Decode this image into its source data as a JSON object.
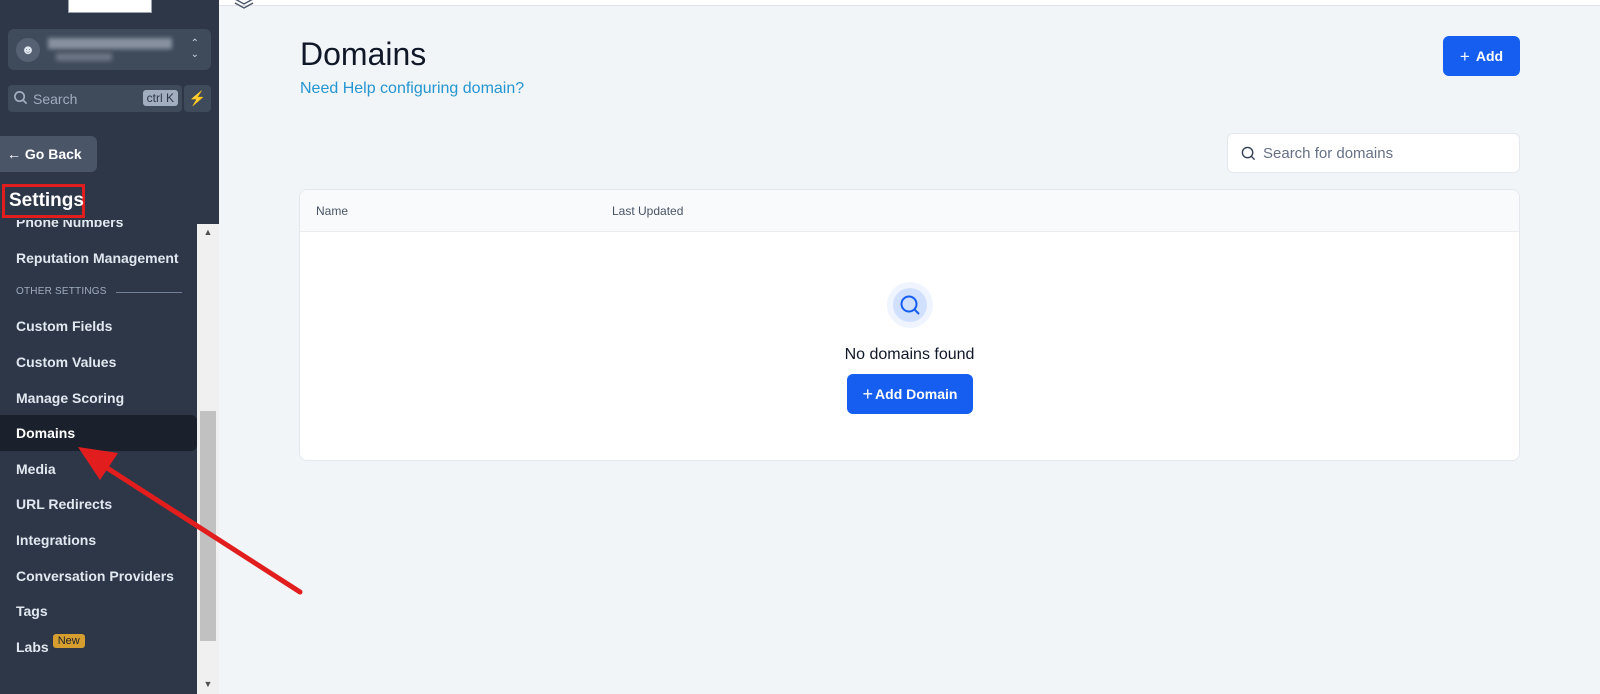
{
  "sidebar": {
    "search": {
      "placeholder": "Search",
      "shortcut": "ctrl K"
    },
    "go_back": "Go Back",
    "settings_title": "Settings",
    "items": [
      {
        "label": "Phone Numbers"
      },
      {
        "label": "Reputation Management"
      },
      {
        "label": "Custom Fields"
      },
      {
        "label": "Custom Values"
      },
      {
        "label": "Manage Scoring"
      },
      {
        "label": "Domains",
        "active": true
      },
      {
        "label": "Media"
      },
      {
        "label": "URL Redirects"
      },
      {
        "label": "Integrations"
      },
      {
        "label": "Conversation Providers"
      },
      {
        "label": "Tags"
      },
      {
        "label": "Labs",
        "badge": "New"
      }
    ],
    "section_label": "OTHER SETTINGS"
  },
  "main": {
    "title": "Domains",
    "help_link": "Need Help configuring domain?",
    "add_button": "Add",
    "search_placeholder": "Search for domains",
    "table": {
      "columns": [
        "Name",
        "Last Updated"
      ],
      "empty_text": "No domains found",
      "empty_button": "Add Domain"
    }
  },
  "colors": {
    "sidebar_bg": "#2d3748",
    "primary": "#155eef",
    "link": "#2596d1",
    "annotation": "#e11d1d",
    "badge": "#d69e2e"
  }
}
